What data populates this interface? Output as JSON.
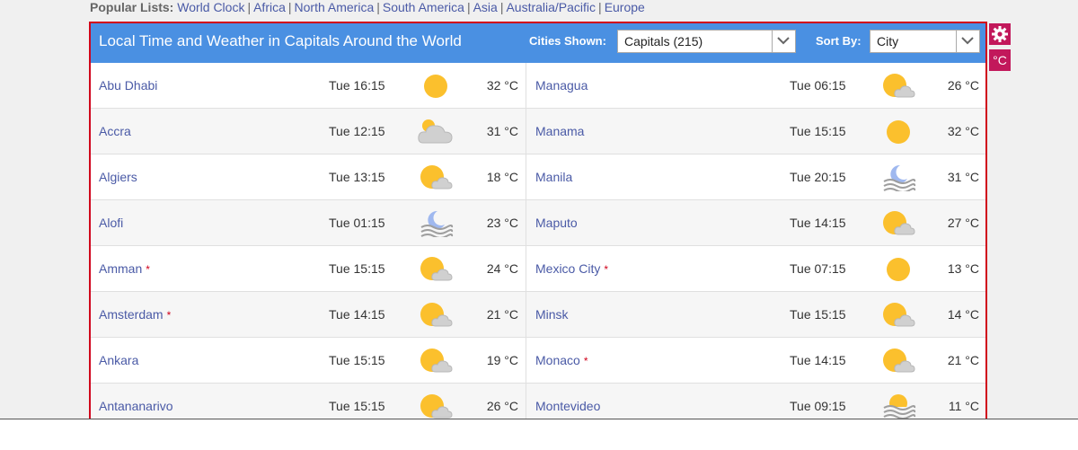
{
  "popular": {
    "label": "Popular Lists:",
    "links": [
      "World Clock",
      "Africa",
      "North America",
      "South America",
      "Asia",
      "Australia/Pacific",
      "Europe"
    ]
  },
  "header": {
    "title": "Local Time and Weather in Capitals Around the World",
    "cities_label": "Cities Shown:",
    "cities_value": "Capitals (215)",
    "sort_label": "Sort By:",
    "sort_value": "City"
  },
  "side": {
    "settings_icon": "gear-icon",
    "unit_label": "°C"
  },
  "left": [
    {
      "city": "Abu Dhabi",
      "star": false,
      "time": "Tue 16:15",
      "icon": "sunny",
      "temp": "32 °C"
    },
    {
      "city": "Accra",
      "star": false,
      "time": "Tue 12:15",
      "icon": "cloudy",
      "temp": "31 °C"
    },
    {
      "city": "Algiers",
      "star": false,
      "time": "Tue 13:15",
      "icon": "partly-cloudy",
      "temp": "18 °C"
    },
    {
      "city": "Alofi",
      "star": false,
      "time": "Tue 01:15",
      "icon": "night-fog",
      "temp": "23 °C"
    },
    {
      "city": "Amman",
      "star": true,
      "time": "Tue 15:15",
      "icon": "partly-cloudy",
      "temp": "24 °C"
    },
    {
      "city": "Amsterdam",
      "star": true,
      "time": "Tue 14:15",
      "icon": "partly-cloudy",
      "temp": "21 °C"
    },
    {
      "city": "Ankara",
      "star": false,
      "time": "Tue 15:15",
      "icon": "partly-cloudy",
      "temp": "19 °C"
    },
    {
      "city": "Antananarivo",
      "star": false,
      "time": "Tue 15:15",
      "icon": "partly-cloudy",
      "temp": "26 °C"
    }
  ],
  "right": [
    {
      "city": "Managua",
      "star": false,
      "time": "Tue 06:15",
      "icon": "partly-cloudy",
      "temp": "26 °C"
    },
    {
      "city": "Manama",
      "star": false,
      "time": "Tue 15:15",
      "icon": "sunny",
      "temp": "32 °C"
    },
    {
      "city": "Manila",
      "star": false,
      "time": "Tue 20:15",
      "icon": "night-fog",
      "temp": "31 °C"
    },
    {
      "city": "Maputo",
      "star": false,
      "time": "Tue 14:15",
      "icon": "partly-cloudy",
      "temp": "27 °C"
    },
    {
      "city": "Mexico City",
      "star": true,
      "time": "Tue 07:15",
      "icon": "sunny",
      "temp": "13 °C"
    },
    {
      "city": "Minsk",
      "star": false,
      "time": "Tue 15:15",
      "icon": "partly-cloudy",
      "temp": "14 °C"
    },
    {
      "city": "Monaco",
      "star": true,
      "time": "Tue 14:15",
      "icon": "partly-cloudy",
      "temp": "21 °C"
    },
    {
      "city": "Montevideo",
      "star": false,
      "time": "Tue 09:15",
      "icon": "sun-fog",
      "temp": "11 °C"
    }
  ],
  "colors": {
    "header_bg": "#4a90e2",
    "link": "#4a5aa6",
    "border": "#d0021b",
    "side_button": "#c2185b",
    "sun": "#fbc02d",
    "cloud": "#d0d0d0"
  }
}
